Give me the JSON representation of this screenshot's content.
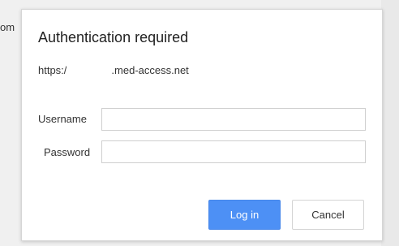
{
  "background": {
    "partial_text": "om"
  },
  "dialog": {
    "title": "Authentication required",
    "url_prefix": "https:/",
    "url_suffix": ".med-access.net",
    "fields": {
      "username_label": "Username",
      "username_value": "",
      "password_label": "Password",
      "password_value": ""
    },
    "buttons": {
      "login_label": "Log in",
      "cancel_label": "Cancel"
    },
    "colors": {
      "primary_button": "#4d90f5",
      "dialog_bg": "#ffffff",
      "page_bg": "#f0f0f0"
    }
  }
}
